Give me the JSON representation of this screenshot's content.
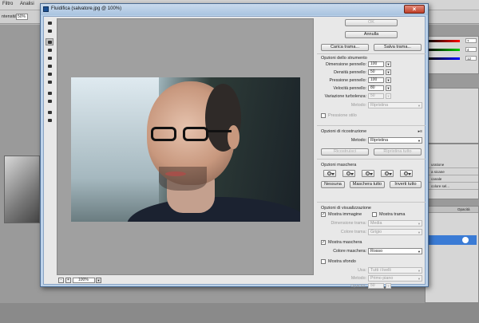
{
  "app": {
    "menu": [
      "Filtro",
      "Analisi"
    ],
    "options_bar": {
      "label": "ntensità:",
      "value": "50%"
    }
  },
  "dialog": {
    "title": "Fluidifica (salvatore.jpg @ 100%)",
    "ok_label": "OK",
    "cancel_label": "Annulla",
    "load_mesh_label": "Carica trama...",
    "save_mesh_label": "Salva trama...",
    "zoom_value": "100%",
    "zoom_minus": "-",
    "zoom_plus": "+"
  },
  "tool_options": {
    "title": "Opzioni dello strumento",
    "fields": [
      {
        "label": "Dimensione pennello:",
        "value": "100",
        "disabled": false
      },
      {
        "label": "Densità pennello:",
        "value": "50",
        "disabled": false
      },
      {
        "label": "Pressione pennello:",
        "value": "100",
        "disabled": false
      },
      {
        "label": "Velocità pennello:",
        "value": "80",
        "disabled": false
      },
      {
        "label": "Variazione turbolenza:",
        "value": "50",
        "disabled": true
      }
    ],
    "method_label": "Metodo:",
    "method_value": "Ripristina",
    "stylus_label": "Pressione stilo"
  },
  "reconstruct": {
    "title": "Opzioni di ricostruzione",
    "method_label": "Metodo:",
    "method_value": "Ripristina",
    "reconstruct_label": "Ricostruisci",
    "restore_all_label": "Ripristina tutto"
  },
  "mask": {
    "title": "Opzioni maschera",
    "none_label": "Nessuna",
    "mask_all_label": "Maschera tutto",
    "invert_all_label": "Inverti tutto"
  },
  "view": {
    "title": "Opzioni di visualizzazione",
    "show_image_label": "Mostra immagine",
    "show_image_checked": true,
    "show_mesh_label": "Mostra trama",
    "show_mesh_checked": false,
    "mesh_size_label": "Dimensione trama:",
    "mesh_size_value": "Media",
    "mesh_color_label": "Colore trama:",
    "mesh_color_value": "Grigio",
    "show_mask_label": "Mostra maschera",
    "show_mask_checked": true,
    "mask_color_label": "Colore maschera:",
    "mask_color_value": "Rosso",
    "show_backdrop_label": "Mostra sfondo",
    "show_backdrop_checked": false,
    "use_label": "Usa:",
    "use_value": "Tutti i livelli",
    "mode_label": "Metodo:",
    "mode_value": "Primo piano",
    "opacity_label": "Opacità:",
    "opacity_value": "50"
  },
  "right_panel": {
    "color_values": [
      "7",
      "4",
      "12"
    ],
    "layer_rows": [
      "uratione",
      "a sicane",
      "canale",
      "colore sel..."
    ],
    "opacity_label": "Opacità"
  },
  "colors": {
    "title_bar": "#a9c3e0",
    "close_button": "#c0402a",
    "selected_layer": "#3a7bd5"
  }
}
